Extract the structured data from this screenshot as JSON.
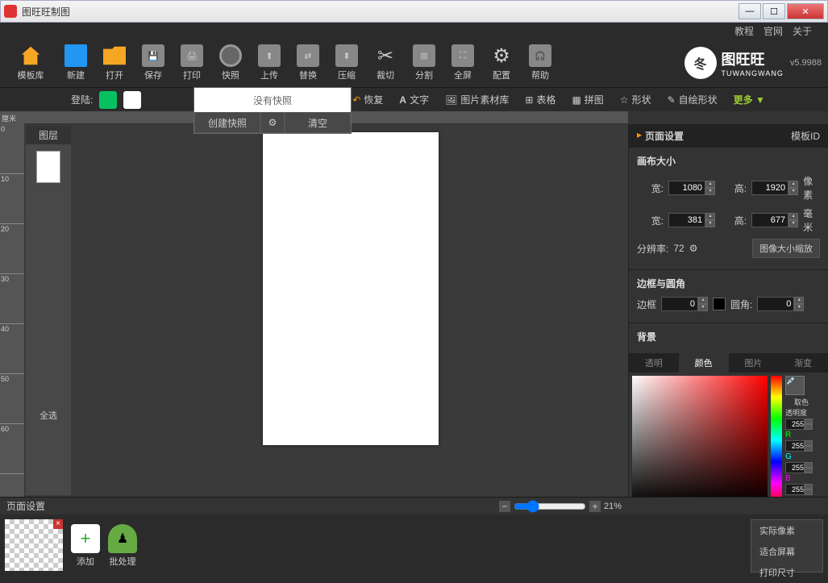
{
  "window": {
    "title": "图旺旺制图"
  },
  "topmenu": [
    "教程",
    "官网",
    "关于"
  ],
  "toolbar": [
    {
      "id": "template-lib",
      "label": "模板库",
      "icon": "home"
    },
    {
      "id": "new",
      "label": "新建",
      "icon": "new"
    },
    {
      "id": "open",
      "label": "打开",
      "icon": "open"
    },
    {
      "id": "save",
      "label": "保存",
      "icon": "save"
    },
    {
      "id": "print",
      "label": "打印",
      "icon": "print"
    },
    {
      "id": "snapshot",
      "label": "快照",
      "icon": "camera"
    },
    {
      "id": "upload",
      "label": "上传",
      "icon": "upload"
    },
    {
      "id": "replace",
      "label": "替换",
      "icon": "replace"
    },
    {
      "id": "compress",
      "label": "压缩",
      "icon": "compress"
    },
    {
      "id": "crop",
      "label": "裁切",
      "icon": "scissors"
    },
    {
      "id": "split",
      "label": "分割",
      "icon": "split"
    },
    {
      "id": "fullscreen",
      "label": "全屏",
      "icon": "fullscreen"
    },
    {
      "id": "config",
      "label": "配置",
      "icon": "gear"
    },
    {
      "id": "help",
      "label": "帮助",
      "icon": "help"
    }
  ],
  "logo": {
    "cn": "图旺旺",
    "en": "TUWANGWANG",
    "version": "v5.9988"
  },
  "login": {
    "label": "登陆:"
  },
  "secondbar": [
    {
      "id": "restore",
      "label": "恢复"
    },
    {
      "id": "text",
      "label": "文字"
    },
    {
      "id": "image-lib",
      "label": "图片素材库"
    },
    {
      "id": "table",
      "label": "表格"
    },
    {
      "id": "mosaic",
      "label": "拼图"
    },
    {
      "id": "shape",
      "label": "形状"
    },
    {
      "id": "draw-shape",
      "label": "自绘形状"
    }
  ],
  "more": "更多 ▼",
  "snapshot_popup": {
    "empty": "没有快照",
    "create": "创建快照",
    "clear": "清空"
  },
  "ruler_unit": "厘米",
  "ruler_ticks": [
    "0",
    "10",
    "20",
    "30",
    "40",
    "50",
    "60"
  ],
  "layer": {
    "title": "图层",
    "select_all": "全选"
  },
  "bottombar": {
    "title": "页面设置",
    "zoom": "21%"
  },
  "footer": {
    "add": "添加",
    "batch": "批处理"
  },
  "contextmenu": [
    "实际像素",
    "适合屏幕",
    "打印尺寸"
  ],
  "rpanel": {
    "title": "页面设置",
    "template_id": "模板ID",
    "canvas_size": "画布大小",
    "w": "宽:",
    "h": "高:",
    "px_w": "1080",
    "px_h": "1920",
    "px_unit": "像素",
    "mm_w": "381",
    "mm_h": "677",
    "mm_unit": "毫米",
    "dpi_label": "分辨率:",
    "dpi": "72",
    "scale_btn": "图像大小缩放",
    "border_section": "边框与圆角",
    "border": "边框",
    "border_v": "0",
    "radius": "圆角:",
    "radius_v": "0",
    "bg_section": "背景",
    "bg_tabs": [
      "透明",
      "颜色",
      "图片",
      "渐变"
    ],
    "eyedrop": "取色",
    "opacity": "透明度",
    "channels": {
      "opacity": "255",
      "R": "255",
      "G": "255",
      "B": "255"
    }
  }
}
